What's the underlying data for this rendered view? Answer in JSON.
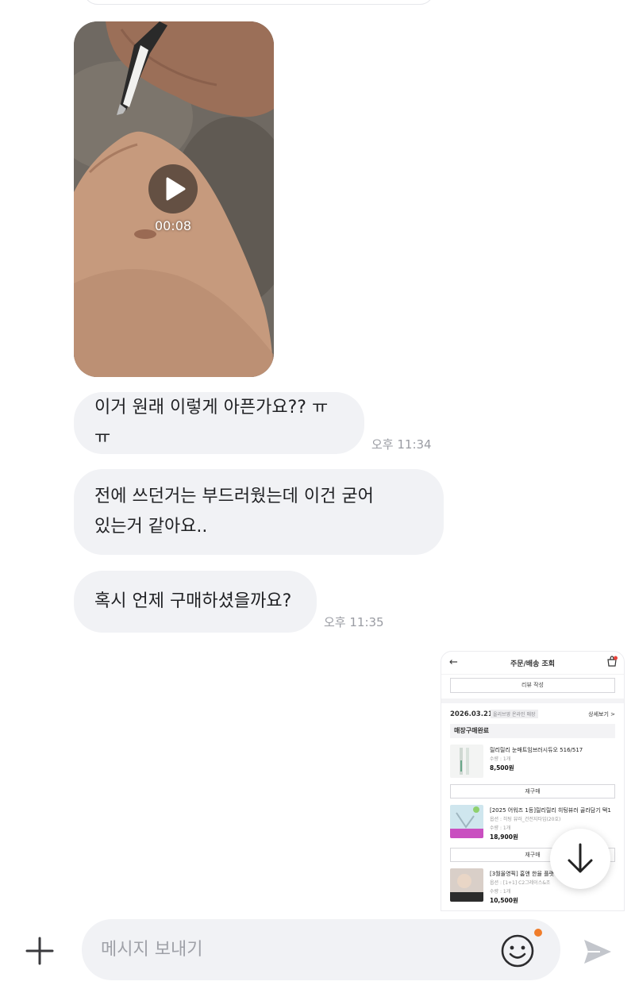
{
  "chat": {
    "video": {
      "duration": "00:08"
    },
    "messages": [
      {
        "lines": [
          "이거 원래 이렇게 아픈가요?? ㅠㅠ"
        ],
        "time": "오후 11:34"
      },
      {
        "lines": [
          "전에 쓰던거는 부드러웠는데 이건 굳어",
          "있는거 같아요.."
        ],
        "time": ""
      },
      {
        "lines": [
          "혹시 언제 구매하셨을까요?"
        ],
        "time": "오후 11:35"
      }
    ],
    "screenshot": {
      "title": "주문/배송 조회",
      "review_button": "리뷰 작성",
      "date": "2026.03.21",
      "date_tag": "올리브영 온라인 매장",
      "detail_link": "상세보기 >",
      "status": "매장구매완료",
      "rebuy_label": "재구매",
      "items": [
        {
          "name": "릴리릴리 눈매트임브러시듀오 516/517",
          "option": "수량 : 1개",
          "price": "8,500원"
        },
        {
          "name": "[2025 어워즈 1등]릴리릴리 히팅뷰러 골라담기 택1",
          "option": "옵션 : 히팅 뷰러_건전지타입(20호)",
          "qty": "수량 : 1개",
          "price": "18,900원"
        },
        {
          "name": "[3월올영픽] 홈앤 한율 플랫 스킨케어 세트",
          "option": "옵션 : [1+1] C2그레이스&조",
          "qty": "수량 : 1개",
          "price": "10,500원",
          "badge": "일시품절"
        }
      ]
    }
  },
  "composer": {
    "placeholder": "메시지 보내기"
  },
  "icons": {
    "plus": "plus-icon",
    "emoji": "emoji-icon",
    "send": "send-icon",
    "play": "play-icon",
    "scroll_down": "arrow-down-icon"
  },
  "colors": {
    "bubble": "#f1f2f5",
    "notification_dot": "#f07d2b"
  }
}
